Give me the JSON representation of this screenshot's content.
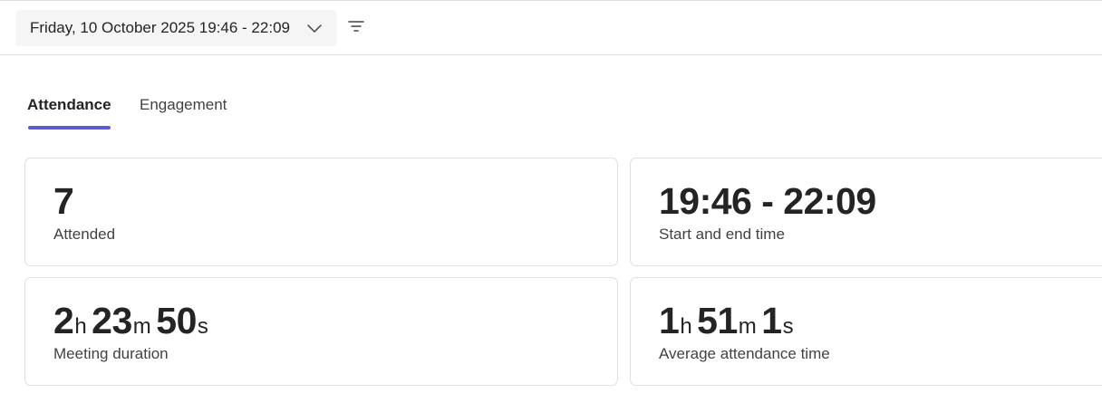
{
  "header": {
    "date_range": "Friday, 10 October 2025 19:46 - 22:09",
    "dropdown_icon": "chevron-down-icon",
    "filter_icon": "filter-icon"
  },
  "tabs": [
    {
      "label": "Attendance",
      "selected": true
    },
    {
      "label": "Engagement",
      "selected": false
    }
  ],
  "accent_color": "#5b5fc7",
  "cards": {
    "attended": {
      "value": "7",
      "label": "Attended"
    },
    "start_end": {
      "value": "19:46 - 22:09",
      "label": "Start and end time"
    },
    "duration": {
      "hours": "2",
      "hours_unit": "h",
      "minutes": "23",
      "minutes_unit": "m",
      "seconds": "50",
      "seconds_unit": "s",
      "label": "Meeting duration"
    },
    "average": {
      "hours": "1",
      "hours_unit": "h",
      "minutes": "51",
      "minutes_unit": "m",
      "seconds": "1",
      "seconds_unit": "s",
      "label": "Average attendance time"
    }
  }
}
